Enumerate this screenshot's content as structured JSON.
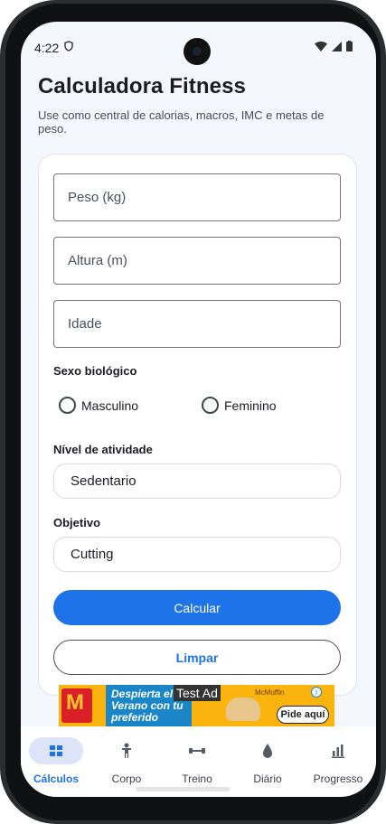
{
  "status_bar": {
    "time": "4:22"
  },
  "header": {
    "title": "Calculadora Fitness",
    "subtitle": "Use como central de calorias, macros, IMC e metas de peso."
  },
  "form": {
    "weight_placeholder": "Peso (kg)",
    "height_placeholder": "Altura (m)",
    "age_placeholder": "Idade",
    "sex_label": "Sexo biológico",
    "sex_options": [
      "Masculino",
      "Feminino"
    ],
    "activity_label": "Nível de atividade",
    "activity_value": "Sedentario",
    "goal_label": "Objetivo",
    "goal_value": "Cutting",
    "calculate_label": "Calcular",
    "clear_label": "Limpar"
  },
  "ad": {
    "badge": "Test Ad",
    "headline": "Despierta el Verano con tu preferido",
    "cta": "Pide aquí",
    "brand_mark": "M",
    "product_tag": "McMuffin"
  },
  "bottom_nav": {
    "items": [
      {
        "label": "Cálculos",
        "icon": "grid-icon",
        "active": true
      },
      {
        "label": "Corpo",
        "icon": "person-icon",
        "active": false
      },
      {
        "label": "Treino",
        "icon": "dumbbell-icon",
        "active": false
      },
      {
        "label": "Diário",
        "icon": "water-drop-icon",
        "active": false
      },
      {
        "label": "Progresso",
        "icon": "bar-chart-icon",
        "active": false
      }
    ]
  },
  "colors": {
    "accent": "#1f73e8",
    "background": "#f4f8fe",
    "nav_active_pill": "#dde4f8"
  }
}
